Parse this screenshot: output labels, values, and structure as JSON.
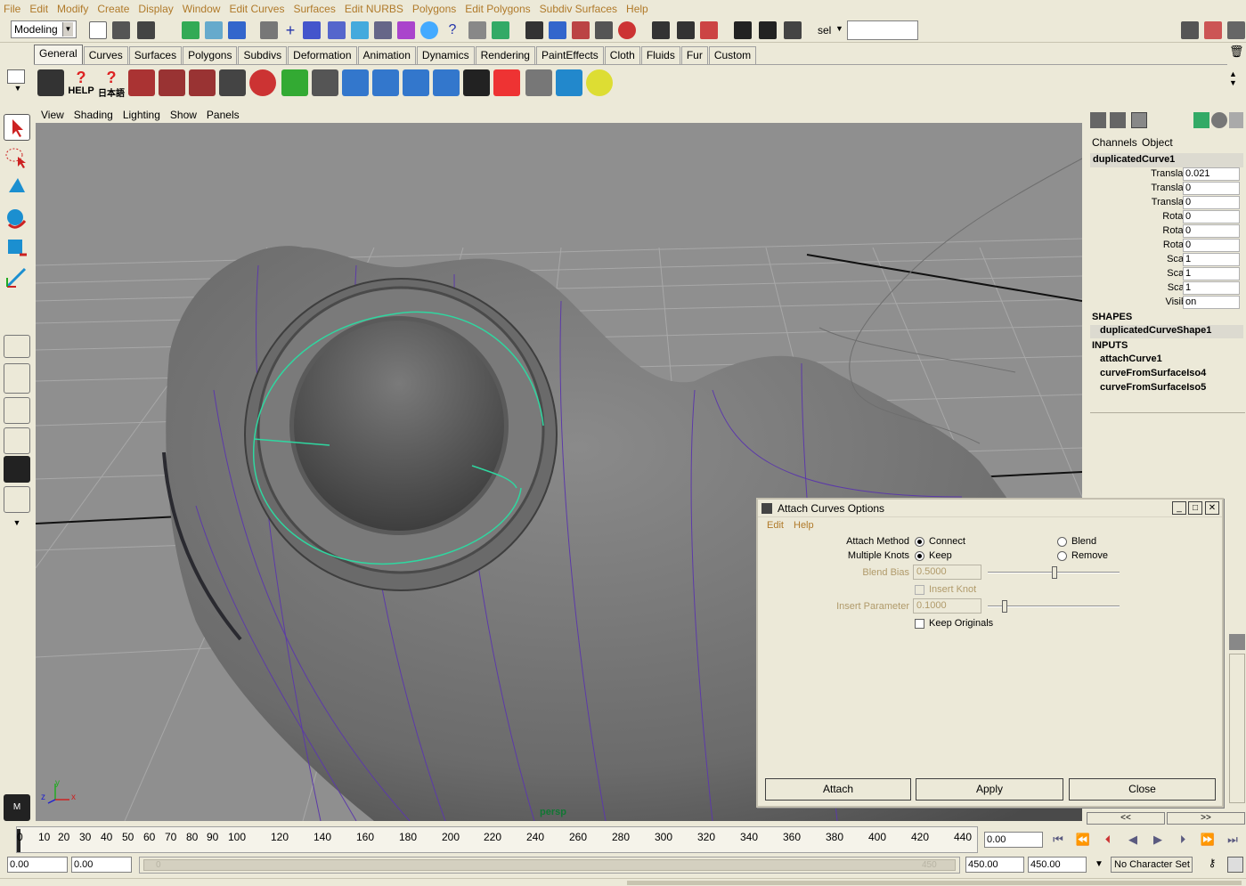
{
  "menubar": {
    "items": [
      "File",
      "Edit",
      "Modify",
      "Create",
      "Display",
      "Window",
      "Edit Curves",
      "Surfaces",
      "Edit NURBS",
      "Polygons",
      "Edit Polygons",
      "Subdiv Surfaces",
      "Help"
    ]
  },
  "statusline": {
    "mode_value": "Modeling",
    "sel_label": "sel",
    "sel_field_value": ""
  },
  "shelf": {
    "tabs": [
      "General",
      "Curves",
      "Surfaces",
      "Polygons",
      "Subdivs",
      "Deformation",
      "Animation",
      "Dynamics",
      "Rendering",
      "PaintEffects",
      "Cloth",
      "Fluids",
      "Fur",
      "Custom"
    ],
    "active_tab": "General",
    "help_label": "HELP",
    "japanese_label": "日本語"
  },
  "panel": {
    "menu": [
      "View",
      "Shading",
      "Lighting",
      "Show",
      "Panels"
    ],
    "camera_label": "persp",
    "axis_x": "x",
    "axis_y": "y",
    "axis_z": "z",
    "accent_curve_color": "#2fd7a0"
  },
  "channelbox": {
    "tabs": [
      "Channels",
      "Object"
    ],
    "object_name": "duplicatedCurve1",
    "channels": [
      {
        "label": "Translate X",
        "value": "0.021"
      },
      {
        "label": "Translate Y",
        "value": "0"
      },
      {
        "label": "Translate Z",
        "value": "0"
      },
      {
        "label": "Rotate X",
        "value": "0"
      },
      {
        "label": "Rotate Y",
        "value": "0"
      },
      {
        "label": "Rotate Z",
        "value": "0"
      },
      {
        "label": "Scale X",
        "value": "1"
      },
      {
        "label": "Scale Y",
        "value": "1"
      },
      {
        "label": "Scale Z",
        "value": "1"
      },
      {
        "label": "Visibility",
        "value": "on"
      }
    ],
    "shapes_header": "SHAPES",
    "shape_name": "duplicatedCurveShape1",
    "inputs_header": "INPUTS",
    "inputs": [
      "attachCurve1",
      "curveFromSurfaceIso4",
      "curveFromSurfaceIso5"
    ],
    "scroll_left": "<<",
    "scroll_right": ">>"
  },
  "dialog": {
    "title": "Attach Curves Options",
    "menu": [
      "Edit",
      "Help"
    ],
    "attach_method_label": "Attach Method",
    "connect_label": "Connect",
    "blend_label": "Blend",
    "multiple_knots_label": "Multiple Knots",
    "keep_label": "Keep",
    "remove_label": "Remove",
    "blend_bias_label": "Blend Bias",
    "blend_bias_value": "0.5000",
    "insert_knot_label": "Insert Knot",
    "insert_parameter_label": "Insert Parameter",
    "insert_parameter_value": "0.1000",
    "keep_originals_label": "Keep Originals",
    "buttons": {
      "attach": "Attach",
      "apply": "Apply",
      "close": "Close"
    }
  },
  "timeslider": {
    "ticks": [
      "0",
      "10",
      "20",
      "30",
      "40",
      "50",
      "60",
      "70",
      "80",
      "90",
      "100",
      "120",
      "140",
      "160",
      "180",
      "200",
      "220",
      "240",
      "260",
      "280",
      "300",
      "320",
      "340",
      "360",
      "380",
      "400",
      "420",
      "440"
    ],
    "current_time": "0.00"
  },
  "rangeslider": {
    "start_time": "0.00",
    "playback_start": "0.00",
    "range_start_inner": "0",
    "range_end_inner": "450",
    "playback_end": "450.00",
    "end_time": "450.00",
    "character_set": "No Character Set"
  }
}
